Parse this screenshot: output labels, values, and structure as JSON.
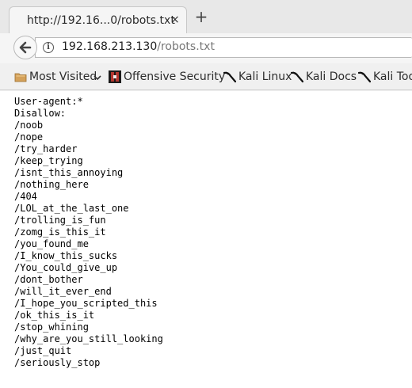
{
  "tab": {
    "title": "http://192.16...0/robots.txt",
    "close_glyph": "×",
    "new_tab_glyph": "+"
  },
  "address": {
    "host": "192.168.213.130",
    "path": "/robots.txt"
  },
  "bookmarks": {
    "most_visited": "Most Visited",
    "offensive_security": "Offensive Security",
    "kali_linux": "Kali Linux",
    "kali_docs": "Kali Docs",
    "kali_tools": "Kali Tools"
  },
  "robots_lines": [
    "User-agent:*",
    "Disallow:",
    "/noob",
    "/nope",
    "/try_harder",
    "/keep_trying",
    "/isnt_this_annoying",
    "/nothing_here",
    "/404",
    "/LOL_at_the_last_one",
    "/trolling_is_fun",
    "/zomg_is_this_it",
    "/you_found_me",
    "/I_know_this_sucks",
    "/You_could_give_up",
    "/dont_bother",
    "/will_it_ever_end",
    "/I_hope_you_scripted_this",
    "/ok_this_is_it",
    "/stop_whining",
    "/why_are_you_still_looking",
    "/just_quit",
    "/seriously_stop"
  ]
}
